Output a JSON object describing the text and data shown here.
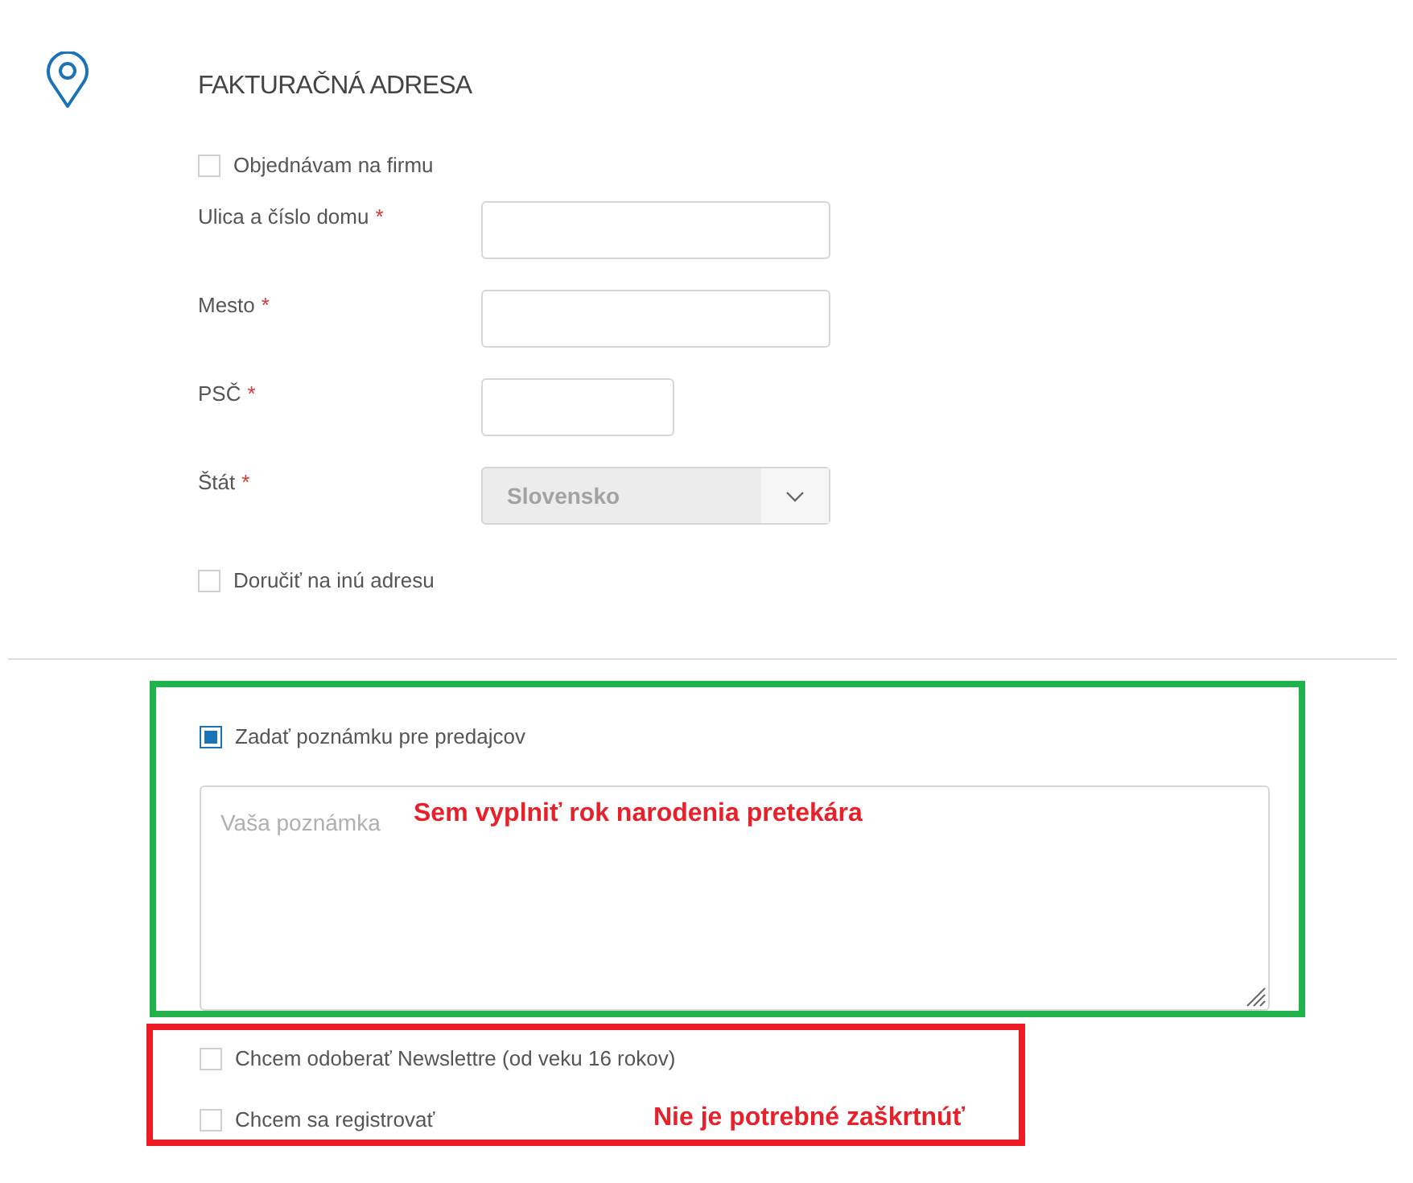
{
  "section": {
    "title": "FAKTURAČNÁ ADRESA"
  },
  "company_checkbox": {
    "label": "Objednávam na firmu",
    "checked": false
  },
  "fields": [
    {
      "kind": "text",
      "label": "Ulica a číslo domu",
      "required_mark": "*"
    },
    {
      "kind": "text",
      "label": "Mesto",
      "required_mark": "*"
    },
    {
      "kind": "short_text",
      "label": "PSČ",
      "required_mark": "*"
    },
    {
      "kind": "select",
      "label": "Štát",
      "required_mark": "*",
      "value": "Slovensko",
      "disabled": true
    }
  ],
  "other_address_checkbox": {
    "label": "Doručiť na inú adresu",
    "checked": false
  },
  "note_checkbox": {
    "label": "Zadať poznámku pre predajcov",
    "checked": true
  },
  "note_field": {
    "placeholder": "Vaša poznámka"
  },
  "extra_checkboxes": [
    {
      "label": "Chcem odoberať Newslettre (od veku 16 rokov)",
      "checked": false
    },
    {
      "label": "Chcem sa registrovať",
      "checked": false
    }
  ],
  "annotations": [
    {
      "color": "#22b24c",
      "note": "Sem vyplniť rok narodenia pretekára"
    },
    {
      "color": "#ed1c24",
      "note": "Nie je potrebné zaškrtnúť"
    }
  ]
}
